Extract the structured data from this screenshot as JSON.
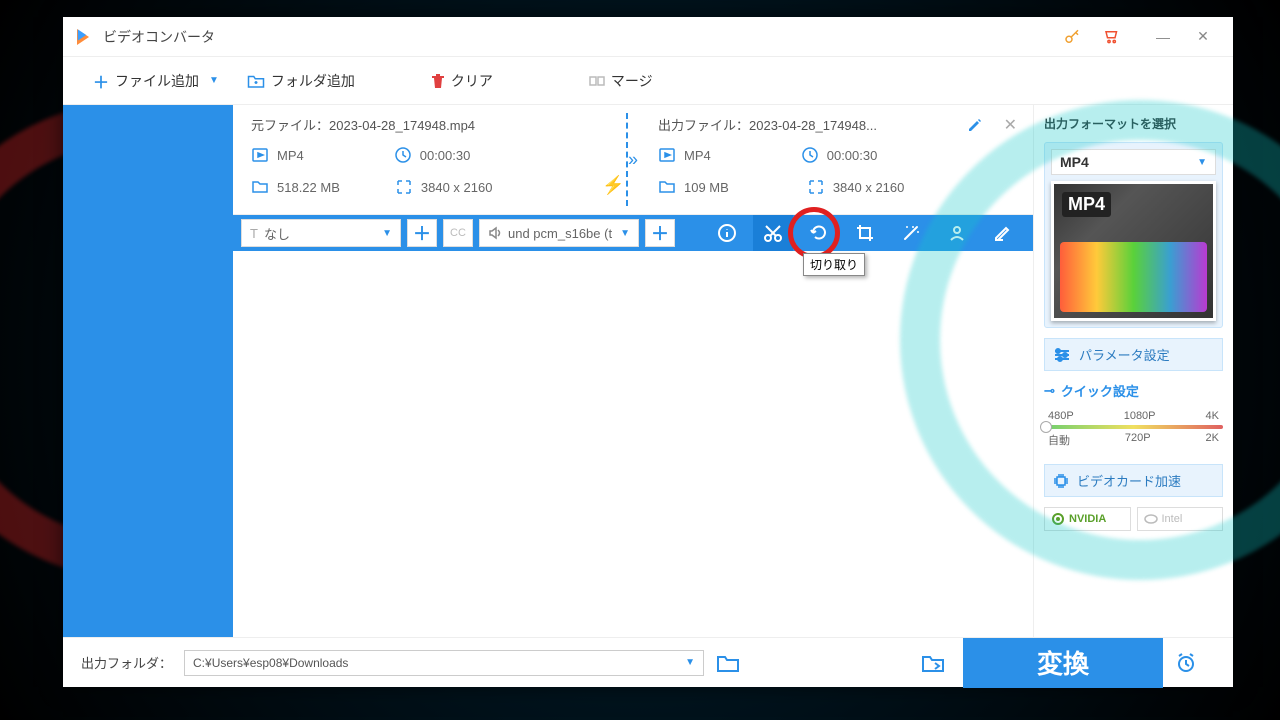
{
  "window": {
    "title": "ビデオコンバータ"
  },
  "toolbar": {
    "add_file": "ファイル追加",
    "add_folder": "フォルダ追加",
    "clear": "クリア",
    "merge": "マージ"
  },
  "file": {
    "source_label": "元ファイル：",
    "source_name": "2023-04-28_174948.mp4",
    "output_label": "出力ファイル：",
    "output_name": "2023-04-28_174948...",
    "src": {
      "format": "MP4",
      "duration": "00:00:30",
      "size": "518.22 MB",
      "resolution": "3840 x 2160"
    },
    "out": {
      "format": "MP4",
      "duration": "00:00:30",
      "size": "109 MB",
      "resolution": "3840 x 2160"
    }
  },
  "actionbar": {
    "subtitle_select": "なし",
    "audio_select": "und pcm_s16be (t",
    "tooltip": "切り取り"
  },
  "right": {
    "title": "出力フォーマットを選択",
    "format_label": "MP4",
    "thumb_label": "MP4",
    "param": "パラメータ設定",
    "quick": "クイック設定",
    "scale_top": [
      "480P",
      "1080P",
      "4K"
    ],
    "scale_bottom": [
      "自動",
      "720P",
      "2K"
    ],
    "gpu": "ビデオカード加速",
    "nvidia": "NVIDIA",
    "intel": "Intel"
  },
  "footer": {
    "label": "出力フォルダ：",
    "path": "C:¥Users¥esp08¥Downloads",
    "convert": "変換"
  }
}
